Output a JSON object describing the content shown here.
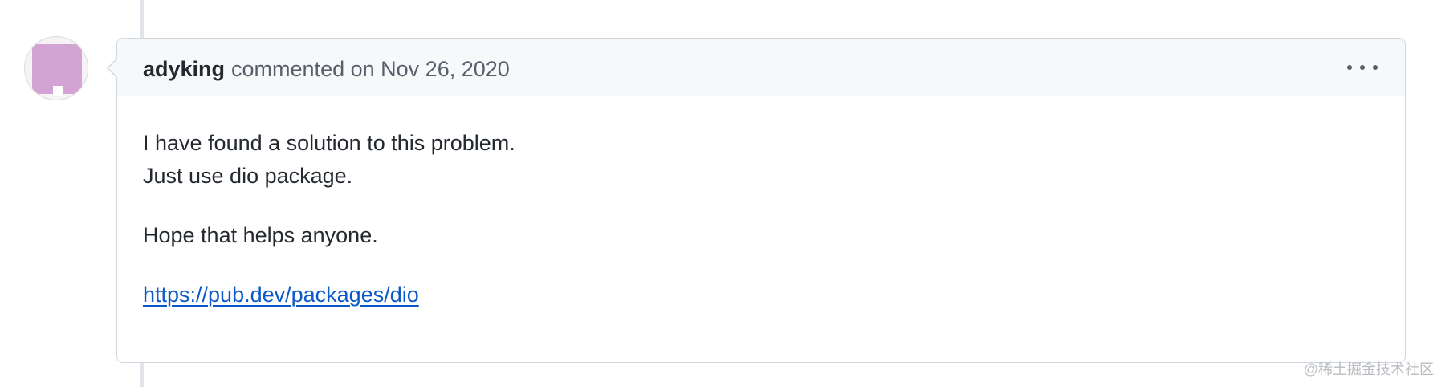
{
  "comment": {
    "author": "adyking",
    "action": "commented on",
    "date": "Nov 26, 2020",
    "menu_icon": "kebab-horizontal-icon",
    "body": {
      "line1": "I have found a solution to this problem.",
      "line2": "Just use dio package.",
      "line3": "Hope that helps anyone.",
      "link_text": "https://pub.dev/packages/dio"
    }
  },
  "watermark": "@稀土掘金技术社区",
  "colors": {
    "avatar": "#d3a3d3",
    "link": "#0a58ca",
    "header_bg": "#f6f8fa",
    "border": "#d0d7de"
  }
}
